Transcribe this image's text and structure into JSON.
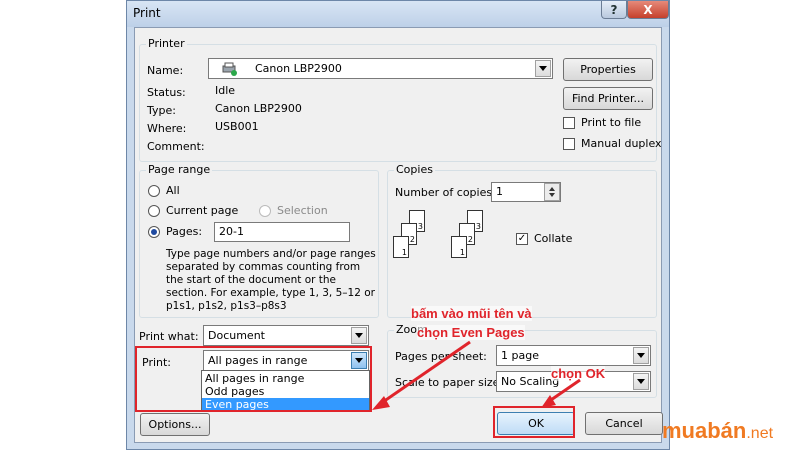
{
  "window": {
    "title": "Print",
    "help_label": "?",
    "close_label": "X"
  },
  "printer": {
    "group_label": "Printer",
    "name_label": "Name:",
    "name_value": "Canon LBP2900",
    "status_label": "Status:",
    "status_value": "Idle",
    "type_label": "Type:",
    "type_value": "Canon LBP2900",
    "where_label": "Where:",
    "where_value": "USB001",
    "comment_label": "Comment:",
    "comment_value": "",
    "properties_label": "Properties",
    "find_printer_label": "Find Printer...",
    "print_to_file_label": "Print to file",
    "manual_duplex_label": "Manual duplex"
  },
  "page_range": {
    "group_label": "Page range",
    "all_label": "All",
    "current_page_label": "Current page",
    "selection_label": "Selection",
    "pages_label": "Pages:",
    "pages_value": "20-1",
    "help_text": "Type page numbers and/or page ranges separated by commas counting from the start of the document or the section. For example, type 1, 3, 5–12 or p1s1, p1s2, p1s3–p8s3"
  },
  "copies": {
    "group_label": "Copies",
    "number_label": "Number of copies:",
    "number_value": "1",
    "collate_label": "Collate",
    "collate_checked": true,
    "stack_left": [
      "3",
      "2",
      "1"
    ],
    "stack_right": [
      "3",
      "2",
      "1"
    ]
  },
  "print_what": {
    "label": "Print what:",
    "value": "Document"
  },
  "print": {
    "label": "Print:",
    "value": "All pages in range",
    "options": [
      "All pages in range",
      "Odd pages",
      "Even pages"
    ],
    "highlighted_option": "Even pages"
  },
  "zoom": {
    "group_label": "Zoom",
    "pages_per_sheet_label": "Pages per sheet:",
    "pages_per_sheet_value": "1 page",
    "scale_label": "Scale to paper size:",
    "scale_value": "No Scaling"
  },
  "buttons": {
    "options_label": "Options...",
    "ok_label": "OK",
    "cancel_label": "Cancel"
  },
  "annotations": {
    "instruction_line1": "bấm vào mũi tên và",
    "instruction_line2": "chọn Even Pages",
    "ok_hint": "chọn OK",
    "color": "#e0242b"
  },
  "watermark": {
    "brand": "muabán",
    "suffix": ".net",
    "color": "#f07a22"
  }
}
